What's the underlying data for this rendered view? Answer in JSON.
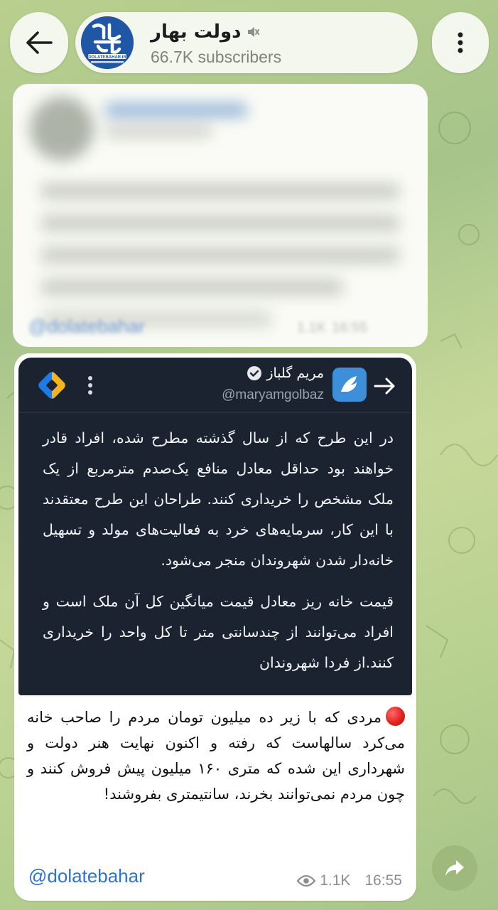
{
  "header": {
    "channel_name": "دولت بهار",
    "subscribers": "66.7K subscribers",
    "avatar_text": "DOLATEBAHAR.IR"
  },
  "blurred_message": {
    "signature": "@dolatebahar",
    "views": "1.1K",
    "time": "16:55"
  },
  "tweet": {
    "author_name": "مریم گلباز",
    "author_handle": "@maryamgolbaz",
    "paragraph_1": "در این طرح که از سال گذشته مطرح شده، افراد قادر خواهند بود حداقل معادل منافع یک‌صدم مترمربع از یک ملک مشخص را خریداری کنند. طراحان این طرح معتقدند با این کار، سرمایه‌های خرد به فعالیت‌های مولد و تسهیل خانه‌دار شدن شهروندان منجر می‌شود.",
    "paragraph_2": "قیمت خانه ریز  معادل قیمت میانگین کل آن ملک است و افراد می‌توانند از چندسانتی متر تا کل واحد را خریداری کنند.از فردا  شهروندان"
  },
  "message": {
    "caption": "مردی که با زیر ده میلیون تومان مردم را صاحب خانه می‌کرد سالهاست که رفته و اکنون نهایت هنر دولت و شهرداری این شده که متری ۱۶۰ میلیون پیش فروش کنند و چون مردم نمی‌توانند بخرند، سانتیمتری بفروشند!",
    "signature": "@dolatebahar",
    "views": "1.1K",
    "time": "16:55"
  },
  "icons": {
    "back": "arrow-left-icon",
    "mute": "muted-speaker-icon",
    "menu": "vertical-dots-icon",
    "verified": "verified-badge-icon",
    "share": "share-forward-icon",
    "views": "eye-icon",
    "red_circle": "red-circle-emoji"
  },
  "colors": {
    "link": "#2f73c9",
    "tweet_card_bg": "#1b2230",
    "share_button": "#9fb87c"
  }
}
